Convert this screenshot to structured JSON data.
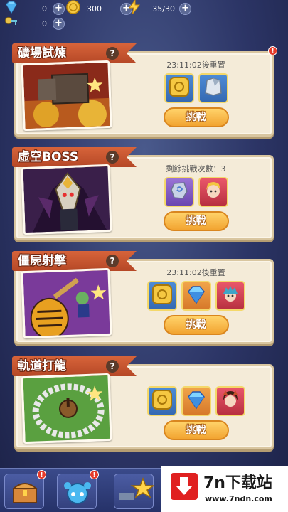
{
  "resources": [
    {
      "icon": "diamond-icon",
      "value": "0"
    },
    {
      "icon": "coin-icon",
      "value": "300"
    },
    {
      "icon": "lightning-icon",
      "value": "35/30"
    },
    {
      "icon": "key-icon",
      "value": "0"
    }
  ],
  "events": [
    {
      "title": "礦場試煉",
      "help": "?",
      "status": "23:11:02後重置",
      "rewards": [
        "coin-icon",
        "armor-icon"
      ],
      "button": "挑戰",
      "alert": "!"
    },
    {
      "title": "虛空BOSS",
      "help": "?",
      "status": "剩餘挑戰次數：3",
      "rewards": [
        "rune-stone-icon",
        "hero-portrait-icon"
      ],
      "button": "挑戰"
    },
    {
      "title": "僵屍射擊",
      "help": "?",
      "status": "23:11:02後重置",
      "rewards": [
        "coin-icon",
        "diamond-icon",
        "hero-portrait-icon"
      ],
      "button": "挑戰"
    },
    {
      "title": "軌道打龍",
      "help": "?",
      "status": "",
      "rewards": [
        "coin-icon",
        "diamond-icon",
        "hero-portrait-icon"
      ],
      "button": "挑戰"
    }
  ],
  "bottom_nav": {
    "alerts": [
      "!",
      "!"
    ]
  },
  "watermark": {
    "main": "7n下载站",
    "sub": "www.7ndn.com"
  }
}
